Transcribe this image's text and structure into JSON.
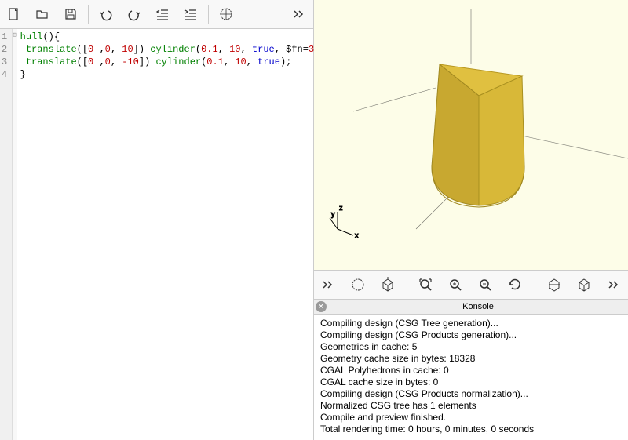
{
  "editor": {
    "line_numbers": [
      "1",
      "2",
      "3",
      "4"
    ],
    "fold_markers": [
      "⊟",
      "",
      "",
      ""
    ],
    "code_lines": [
      {
        "tokens": [
          {
            "t": "hull",
            "c": "kw"
          },
          {
            "t": "(){"
          }
        ]
      },
      {
        "tokens": [
          {
            "t": " "
          },
          {
            "t": "translate",
            "c": "kw"
          },
          {
            "t": "(["
          },
          {
            "t": "0",
            "c": "num"
          },
          {
            "t": " ,"
          },
          {
            "t": "0",
            "c": "num"
          },
          {
            "t": ", "
          },
          {
            "t": "10",
            "c": "num"
          },
          {
            "t": "]) "
          },
          {
            "t": "cylinder",
            "c": "kw"
          },
          {
            "t": "("
          },
          {
            "t": "0.1",
            "c": "num"
          },
          {
            "t": ", "
          },
          {
            "t": "10",
            "c": "num"
          },
          {
            "t": ", "
          },
          {
            "t": "true",
            "c": "bool"
          },
          {
            "t": ", $fn="
          },
          {
            "t": "3",
            "c": "num"
          },
          {
            "t": ");"
          }
        ]
      },
      {
        "tokens": [
          {
            "t": " "
          },
          {
            "t": "translate",
            "c": "kw"
          },
          {
            "t": "(["
          },
          {
            "t": "0",
            "c": "num"
          },
          {
            "t": " ,"
          },
          {
            "t": "0",
            "c": "num"
          },
          {
            "t": ", "
          },
          {
            "t": "-10",
            "c": "num"
          },
          {
            "t": "]) "
          },
          {
            "t": "cylinder",
            "c": "kw"
          },
          {
            "t": "("
          },
          {
            "t": "0.1",
            "c": "num"
          },
          {
            "t": ", "
          },
          {
            "t": "10",
            "c": "num"
          },
          {
            "t": ", "
          },
          {
            "t": "true",
            "c": "bool"
          },
          {
            "t": ");"
          }
        ]
      },
      {
        "tokens": [
          {
            "t": "}"
          }
        ]
      }
    ]
  },
  "console": {
    "title": "Konsole",
    "lines": [
      "Compiling design (CSG Tree generation)...",
      "Compiling design (CSG Products generation)...",
      "Geometries in cache: 5",
      "Geometry cache size in bytes: 18328",
      "CGAL Polyhedrons in cache: 0",
      "CGAL cache size in bytes: 0",
      "Compiling design (CSG Products normalization)...",
      "Normalized CSG tree has 1 elements",
      "Compile and preview finished.",
      "Total rendering time: 0 hours, 0 minutes, 0 seconds"
    ]
  },
  "axes": {
    "x": "x",
    "y": "y",
    "z": "z"
  }
}
